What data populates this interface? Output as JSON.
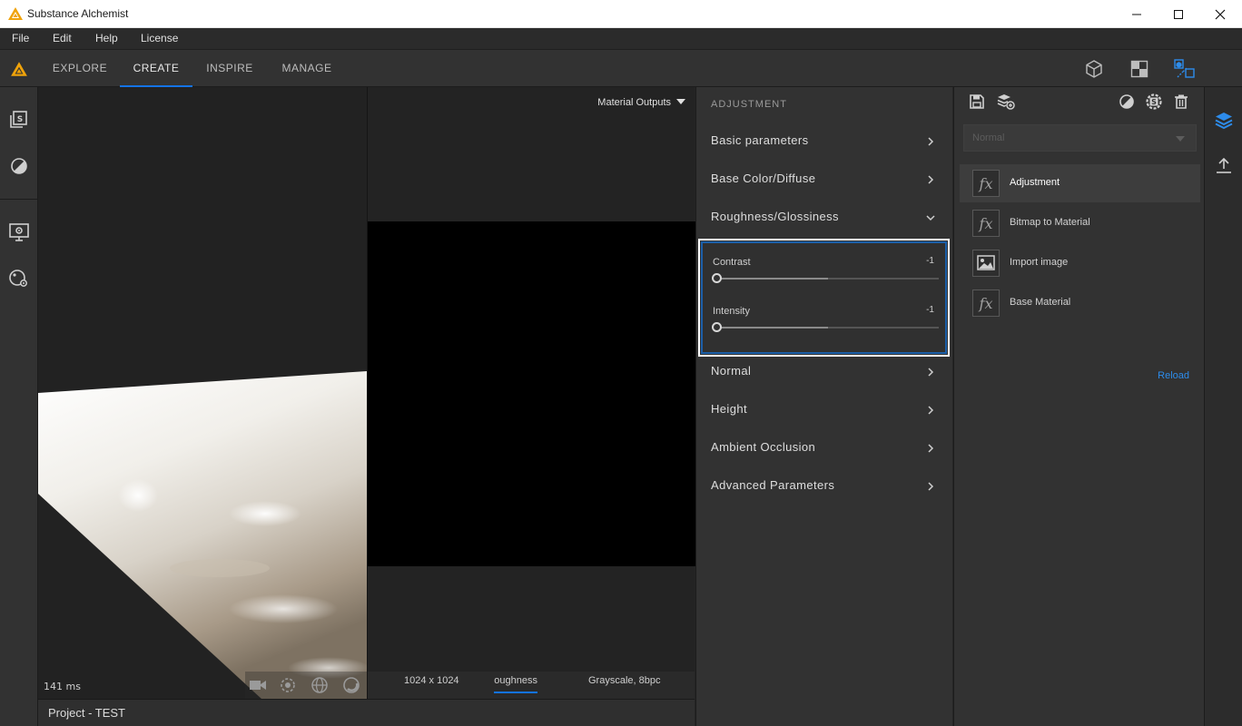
{
  "window": {
    "title": "Substance Alchemist"
  },
  "menu": {
    "items": [
      "File",
      "Edit",
      "Help",
      "License"
    ]
  },
  "nav": {
    "tabs": [
      {
        "label": "EXPLORE",
        "active": false
      },
      {
        "label": "CREATE",
        "active": true
      },
      {
        "label": "INSPIRE",
        "active": false
      },
      {
        "label": "MANAGE",
        "active": false
      }
    ],
    "view_icons": [
      "cube-view-icon",
      "checker-view-icon",
      "split-view-icon"
    ]
  },
  "left_sidebar": {
    "icons": [
      "material-library-icon",
      "color-wheel-icon",
      "display-settings-icon",
      "environment-settings-icon"
    ]
  },
  "viewport3d": {
    "render_time": "141 ms",
    "tools": [
      "camera-icon",
      "rotate-light-icon",
      "globe-icon",
      "sphere-icon"
    ]
  },
  "viewport2d": {
    "output_dropdown": "Material Outputs",
    "resolution": "1024 x 1024",
    "channel": "Roughness",
    "format": "Grayscale, 8bpc"
  },
  "bottom_bar": {
    "project": "Project - TEST"
  },
  "adjustment": {
    "header": "ADJUSTMENT",
    "sections_top": [
      {
        "label": "Basic parameters",
        "expanded": false
      },
      {
        "label": "Base Color/Diffuse",
        "expanded": false
      },
      {
        "label": "Roughness/Glossiness",
        "expanded": true
      }
    ],
    "roughness_params": [
      {
        "label": "Contrast",
        "value": "-1",
        "value_fraction": 0.0,
        "midpoint_fraction": 0.5
      },
      {
        "label": "Intensity",
        "value": "-1",
        "value_fraction": 0.0,
        "midpoint_fraction": 0.5
      }
    ],
    "sections_bottom": [
      {
        "label": "Normal",
        "expanded": false
      },
      {
        "label": "Height",
        "expanded": false
      },
      {
        "label": "Ambient Occlusion",
        "expanded": false
      },
      {
        "label": "Advanced Parameters",
        "expanded": false
      }
    ]
  },
  "layers": {
    "toolbar_icons": [
      "save-icon",
      "add-layer-icon",
      "mask-icon",
      "settings-layer-icon",
      "delete-icon"
    ],
    "blend_mode": "Normal",
    "items": [
      {
        "name": "Adjustment",
        "thumb": "fx-icon",
        "active": true
      },
      {
        "name": "Bitmap to Material",
        "thumb": "fx-icon",
        "active": false
      },
      {
        "name": "Import image",
        "thumb": "image-icon",
        "active": false
      },
      {
        "name": "Base Material",
        "thumb": "fx-icon",
        "active": false
      }
    ],
    "reload_label": "Reload"
  },
  "right_strip": {
    "icons": [
      "layers-icon",
      "export-icon"
    ]
  },
  "colors": {
    "accent": "#1473e6",
    "link": "#2d8ceb",
    "highlight_border": "#1c5fa8"
  }
}
